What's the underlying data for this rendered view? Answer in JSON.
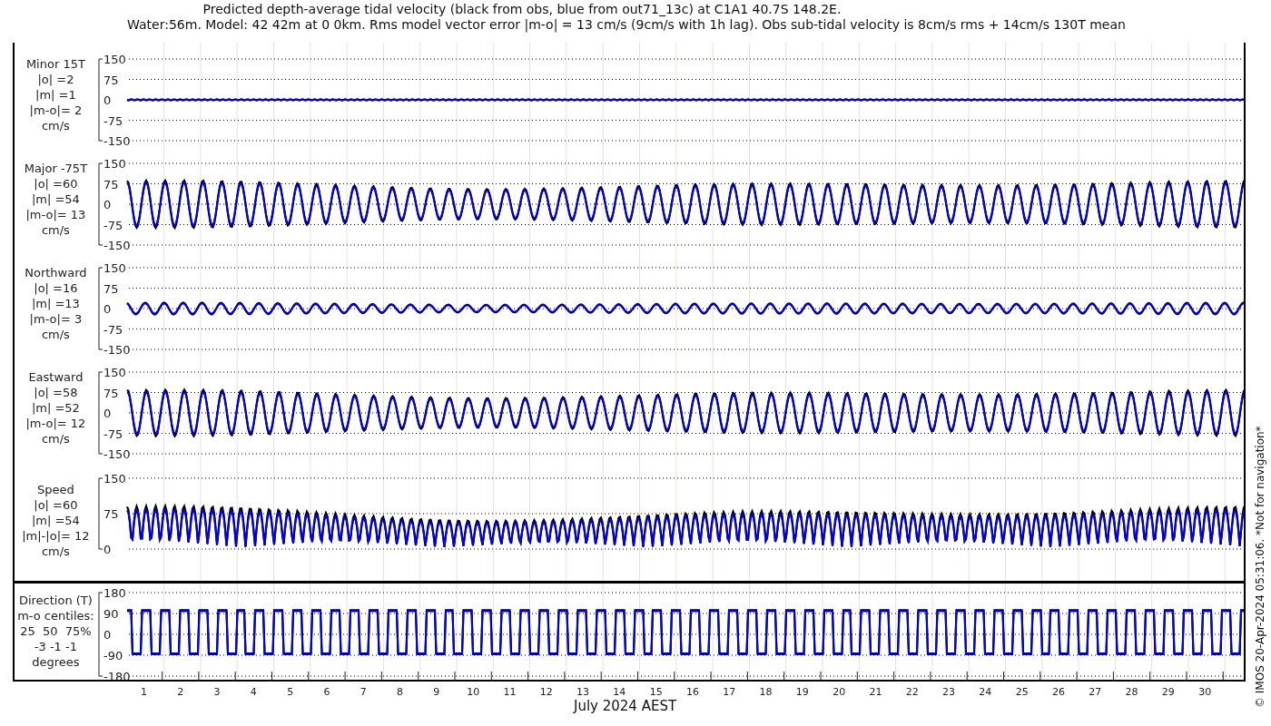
{
  "title": "Predicted depth-average tidal velocity (black from obs, blue from out71_13c) at C1A1 40.7S 148.2E.",
  "subtitle": "Water:56m. Model: 42 42m at 0 0km. Rms model vector error |m-o| = 13 cm/s (9cm/s with 1h lag). Obs sub-tidal velocity is 8cm/s rms + 14cm/s 130T mean",
  "panels": [
    {
      "kind": "minor",
      "label": [
        "Minor 15T",
        "|o| =2",
        "|m| =1",
        "|m-o|= 2",
        "cm/s"
      ],
      "yticks": [
        "150",
        "75",
        "0",
        "-75",
        "-150"
      ]
    },
    {
      "kind": "major",
      "label": [
        "Major -75T",
        "|o| =60",
        "|m| =54",
        "|m-o|= 13",
        "cm/s"
      ],
      "yticks": [
        "150",
        "75",
        "0",
        "-75",
        "-150"
      ]
    },
    {
      "kind": "north",
      "label": [
        "Northward",
        "|o| =16",
        "|m| =13",
        "|m-o|= 3",
        "cm/s"
      ],
      "yticks": [
        "150",
        "75",
        "0",
        "-75",
        "-150"
      ]
    },
    {
      "kind": "east",
      "label": [
        "Eastward",
        "|o| =58",
        "|m| =52",
        "|m-o|= 12",
        "cm/s"
      ],
      "yticks": [
        "150",
        "75",
        "0",
        "-75",
        "-150"
      ]
    },
    {
      "kind": "speed",
      "label": [
        "Speed",
        "|o| =60",
        "|m| =54",
        "|m|-|o|= 12",
        "cm/s"
      ],
      "yticks": [
        "150",
        "75",
        "0"
      ]
    },
    {
      "kind": "direction",
      "label": [
        "Direction (T)",
        "m-o centiles:",
        "25  50  75%",
        "-3 -1 -1",
        "degrees"
      ],
      "yticks": [
        "180",
        "90",
        "0",
        "-90",
        "-180"
      ]
    }
  ],
  "xticks": [
    "1",
    "2",
    "3",
    "4",
    "5",
    "6",
    "7",
    "8",
    "9",
    "10",
    "11",
    "12",
    "13",
    "14",
    "15",
    "16",
    "17",
    "18",
    "19",
    "20",
    "21",
    "22",
    "23",
    "24",
    "25",
    "26",
    "27",
    "28",
    "29",
    "30"
  ],
  "xlabel": "July 2024 AEST",
  "credit": "© IMOS 20-Apr-2024 05:31:06. *Not for navigation*"
}
